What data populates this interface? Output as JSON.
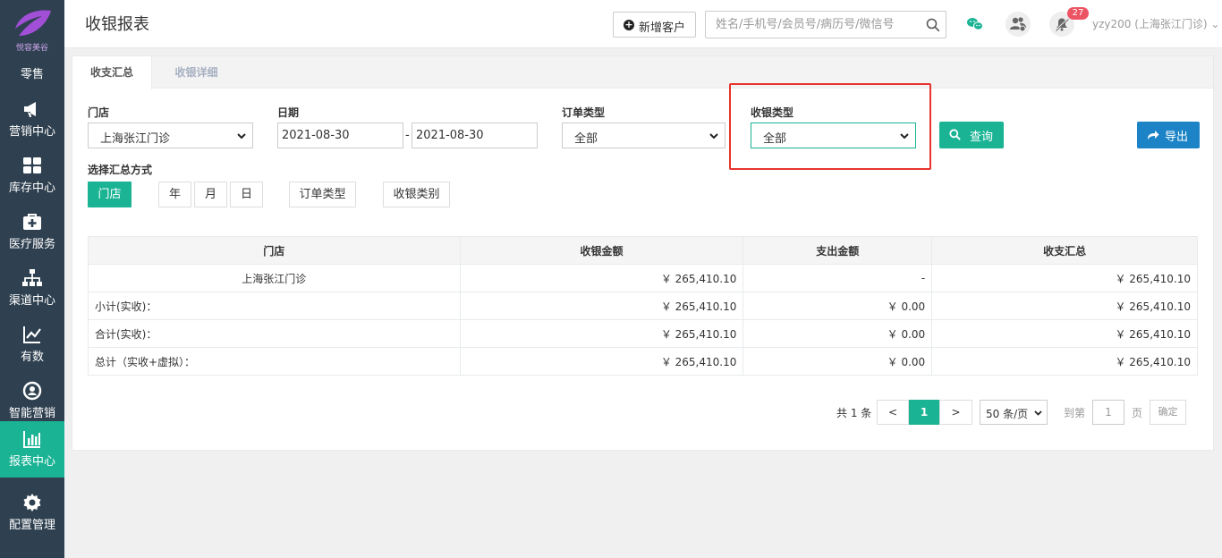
{
  "sidebar": {
    "logo_text": "悦容美谷",
    "logo_sub": "零售",
    "items": [
      {
        "label": "营销中心",
        "icon": "megaphone-icon"
      },
      {
        "label": "库存中心",
        "icon": "grid-icon"
      },
      {
        "label": "医疗服务",
        "icon": "medkit-icon"
      },
      {
        "label": "渠道中心",
        "icon": "sitemap-icon"
      },
      {
        "label": "有数",
        "icon": "line-chart-icon"
      },
      {
        "label": "智能营销",
        "icon": "smart-marketing-icon"
      },
      {
        "label": "报表中心",
        "icon": "bar-chart-icon"
      },
      {
        "label": "配置管理",
        "icon": "gear-icon"
      }
    ],
    "active_color": "#1ab394"
  },
  "header": {
    "title": "收银报表",
    "new_customer_label": "新增客户",
    "search_placeholder": "姓名/手机号/会员号/病历号/微信号",
    "notification_count": "27",
    "user": "yzy200 (上海张江门诊)"
  },
  "tabs": [
    {
      "label": "收支汇总",
      "active": true
    },
    {
      "label": "收银详细",
      "active": false
    }
  ],
  "filters": {
    "store_label": "门店",
    "store_value": "上海张江门诊",
    "date_label": "日期",
    "date_from": "2021-08-30",
    "date_sep": "-",
    "date_to": "2021-08-30",
    "order_type_label": "订单类型",
    "order_type_value": "全部",
    "cash_type_label": "收银类型",
    "cash_type_value": "全部",
    "query_label": "查询",
    "export_label": "导出"
  },
  "group_by": {
    "label": "选择汇总方式",
    "options": [
      "门店",
      "年",
      "月",
      "日",
      "订单类型",
      "收银类别"
    ],
    "selected": "门店"
  },
  "table": {
    "headers": [
      "门店",
      "收银金额",
      "支出金额",
      "收支汇总"
    ],
    "rows": [
      [
        "上海张江门诊",
        "￥ 265,410.10",
        "-",
        "￥ 265,410.10"
      ],
      [
        "小计(实收)：",
        "￥ 265,410.10",
        "￥ 0.00",
        "￥ 265,410.10"
      ],
      [
        "合计(实收)：",
        "￥ 265,410.10",
        "￥ 0.00",
        "￥ 265,410.10"
      ],
      [
        "总计（实收+虚拟）：",
        "￥ 265,410.10",
        "￥ 0.00",
        "￥ 265,410.10"
      ]
    ]
  },
  "pagination": {
    "total": "共 1 条",
    "prev": "<",
    "current": "1",
    "next": ">",
    "page_size": "50 条/页",
    "goto_label": "到第",
    "goto_value": "1",
    "page_label": "页",
    "confirm": "确定"
  },
  "colors": {
    "sidebar_bg": "#2f4050",
    "primary": "#1ab394",
    "export": "#1c84c6",
    "highlight": "#e8332e",
    "badge": "#ed5565"
  }
}
